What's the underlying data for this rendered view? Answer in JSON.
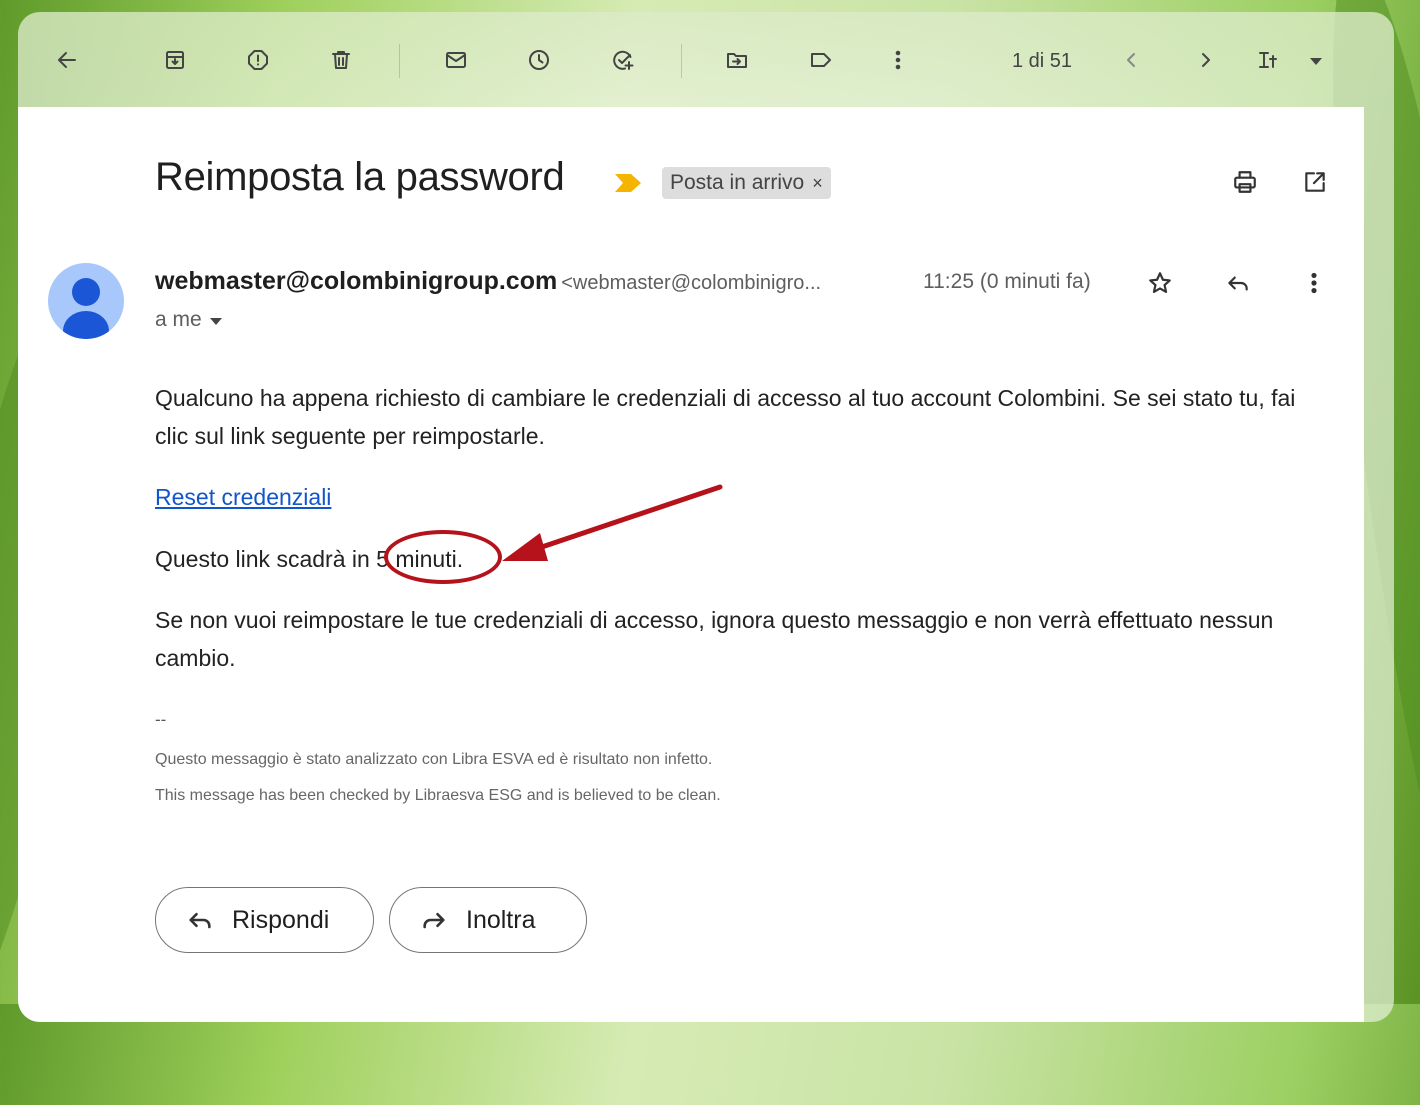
{
  "toolbar": {
    "pager": "1 di 51"
  },
  "email": {
    "subject": "Reimposta la password",
    "label": "Posta in arrivo",
    "label_close": "×",
    "sender_name": "webmaster@colombinigroup.com",
    "sender_address": "<webmaster@colombinigro...",
    "time": "11:25 (0 minuti fa)",
    "recipient": "a me",
    "body": {
      "para1": "Qualcuno ha appena richiesto di cambiare le credenziali di accesso al tuo account Colombini. Se sei stato tu, fai clic sul link seguente per reimpostarle.",
      "link": "Reset credenziali",
      "para2": "Questo link scadrà in 5 minuti.",
      "para3": "Se non vuoi reimpostare le tue credenziali di accesso, ignora questo messaggio e non verrà effettuato nessun cambio.",
      "signature_sep": "--",
      "footer_it": "Questo messaggio è stato analizzato con Libra ESVA ed è risultato non infetto.",
      "footer_en": "This message has been checked by Libraesva ESG and is believed to be clean."
    }
  },
  "actions": {
    "reply": "Rispondi",
    "forward": "Inoltra"
  },
  "icons": {
    "back": "arrow-left-icon",
    "archive": "archive-icon",
    "spam": "report-spam-icon",
    "delete": "trash-icon",
    "unread": "mail-icon",
    "snooze": "clock-icon",
    "task": "add-task-icon",
    "move": "move-to-folder-icon",
    "label": "label-icon",
    "more": "more-vertical-icon",
    "prev": "chevron-left-icon",
    "next": "chevron-right-icon",
    "input_tools": "input-tools-icon",
    "print": "print-icon",
    "new_window": "open-in-new-icon",
    "star": "star-icon",
    "reply": "reply-icon"
  },
  "colors": {
    "link": "#1155cc",
    "annotation": "#b5121b",
    "important_marker": "#f4b400",
    "avatar_bg": "#a8c7fa",
    "avatar_fg": "#1a56d6"
  }
}
